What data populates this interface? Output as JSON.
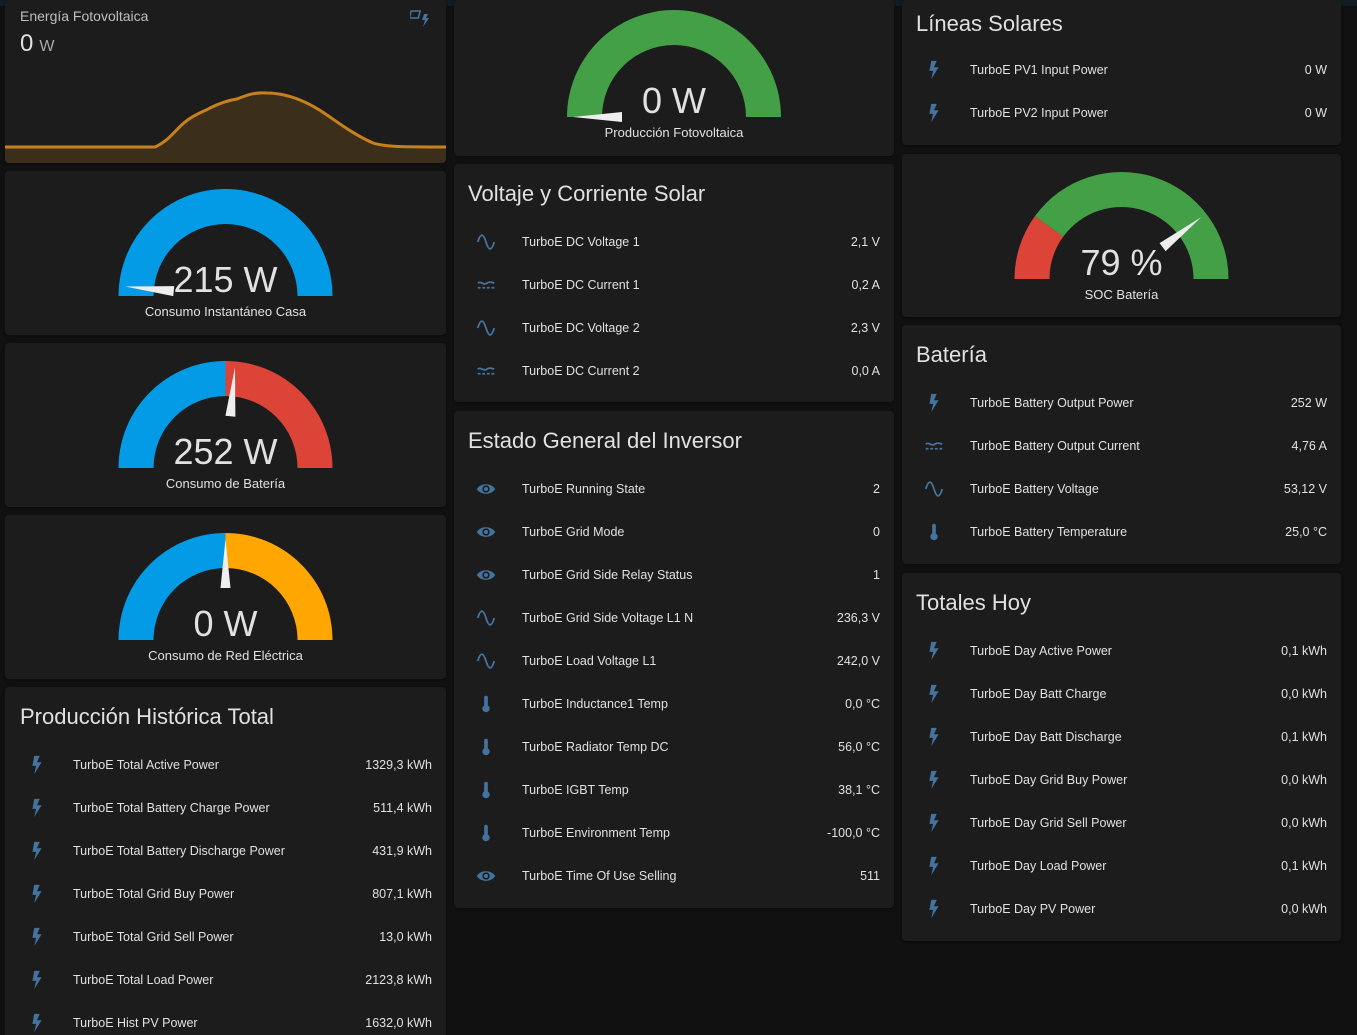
{
  "colors": {
    "background": "#111111",
    "card": "#1c1c1c",
    "icon": "#44739e",
    "gauge_blue": "#039be5",
    "gauge_green": "#43a047",
    "gauge_red": "#db4437",
    "gauge_orange": "#ffa600",
    "sensor_line": "#c8801c"
  },
  "energy_card": {
    "title": "Energía Fotovoltaica",
    "value": "0",
    "unit": "W",
    "icon": "solar-power-icon"
  },
  "gauges": {
    "production": {
      "value": "0 W",
      "name": "Producción Fotovoltaica",
      "level": 0.0
    },
    "house": {
      "value": "215 W",
      "name": "Consumo Instantáneo Casa",
      "level": 0.03
    },
    "battery": {
      "value": "252 W",
      "name": "Consumo de Batería",
      "level": 0.53
    },
    "grid": {
      "value": "0 W",
      "name": "Consumo de Red Eléctrica",
      "level": 0.5
    },
    "soc": {
      "value": "79 %",
      "name": "SOC Batería",
      "level": 0.79
    }
  },
  "cards": {
    "solar_lines": {
      "title": "Líneas Solares",
      "rows": [
        {
          "icon": "flash-icon",
          "name": "TurboE PV1 Input Power",
          "value": "0 W"
        },
        {
          "icon": "flash-icon",
          "name": "TurboE PV2 Input Power",
          "value": "0 W"
        }
      ]
    },
    "solar_voltage": {
      "title": "Voltaje y Corriente Solar",
      "rows": [
        {
          "icon": "sine-wave-icon",
          "name": "TurboE DC Voltage 1",
          "value": "2,1 V"
        },
        {
          "icon": "current-dc-icon",
          "name": "TurboE DC Current 1",
          "value": "0,2 A"
        },
        {
          "icon": "sine-wave-icon",
          "name": "TurboE DC Voltage 2",
          "value": "2,3 V"
        },
        {
          "icon": "current-dc-icon",
          "name": "TurboE DC Current 2",
          "value": "0,0 A"
        }
      ]
    },
    "inverter": {
      "title": "Estado General del Inversor",
      "rows": [
        {
          "icon": "eye-icon",
          "name": "TurboE Running State",
          "value": "2"
        },
        {
          "icon": "eye-icon",
          "name": "TurboE Grid Mode",
          "value": "0"
        },
        {
          "icon": "eye-icon",
          "name": "TurboE Grid Side Relay Status",
          "value": "1"
        },
        {
          "icon": "sine-wave-icon",
          "name": "TurboE Grid Side Voltage L1 N",
          "value": "236,3 V"
        },
        {
          "icon": "sine-wave-icon",
          "name": "TurboE Load Voltage L1",
          "value": "242,0 V"
        },
        {
          "icon": "thermometer-icon",
          "name": "TurboE Inductance1 Temp",
          "value": "0,0 °C"
        },
        {
          "icon": "thermometer-icon",
          "name": "TurboE Radiator Temp DC",
          "value": "56,0 °C"
        },
        {
          "icon": "thermometer-icon",
          "name": "TurboE IGBT Temp",
          "value": "38,1 °C"
        },
        {
          "icon": "thermometer-icon",
          "name": "TurboE Environment Temp",
          "value": "-100,0 °C"
        },
        {
          "icon": "eye-icon",
          "name": "TurboE Time Of Use Selling",
          "value": "511"
        }
      ]
    },
    "historic": {
      "title": "Producción Histórica Total",
      "rows": [
        {
          "icon": "flash-icon",
          "name": "TurboE Total Active Power",
          "value": "1329,3 kWh"
        },
        {
          "icon": "flash-icon",
          "name": "TurboE Total Battery Charge Power",
          "value": "511,4 kWh"
        },
        {
          "icon": "flash-icon",
          "name": "TurboE Total Battery Discharge Power",
          "value": "431,9 kWh"
        },
        {
          "icon": "flash-icon",
          "name": "TurboE Total Grid Buy Power",
          "value": "807,1 kWh"
        },
        {
          "icon": "flash-icon",
          "name": "TurboE Total Grid Sell Power",
          "value": "13,0 kWh"
        },
        {
          "icon": "flash-icon",
          "name": "TurboE Total Load Power",
          "value": "2123,8 kWh"
        },
        {
          "icon": "flash-icon",
          "name": "TurboE Hist PV Power",
          "value": "1632,0 kWh"
        }
      ]
    },
    "battery": {
      "title": "Batería",
      "rows": [
        {
          "icon": "flash-icon",
          "name": "TurboE Battery Output Power",
          "value": "252 W"
        },
        {
          "icon": "current-dc-icon",
          "name": "TurboE Battery Output Current",
          "value": "4,76 A"
        },
        {
          "icon": "sine-wave-icon",
          "name": "TurboE Battery Voltage",
          "value": "53,12 V"
        },
        {
          "icon": "thermometer-icon",
          "name": "TurboE Battery Temperature",
          "value": "25,0 °C"
        }
      ]
    },
    "today": {
      "title": "Totales Hoy",
      "rows": [
        {
          "icon": "flash-icon",
          "name": "TurboE Day Active Power",
          "value": "0,1 kWh"
        },
        {
          "icon": "flash-icon",
          "name": "TurboE Day Batt Charge",
          "value": "0,0 kWh"
        },
        {
          "icon": "flash-icon",
          "name": "TurboE Day Batt Discharge",
          "value": "0,1 kWh"
        },
        {
          "icon": "flash-icon",
          "name": "TurboE Day Grid Buy Power",
          "value": "0,0 kWh"
        },
        {
          "icon": "flash-icon",
          "name": "TurboE Day Grid Sell Power",
          "value": "0,0 kWh"
        },
        {
          "icon": "flash-icon",
          "name": "TurboE Day Load Power",
          "value": "0,1 kWh"
        },
        {
          "icon": "flash-icon",
          "name": "TurboE Day PV Power",
          "value": "0,0 kWh"
        }
      ]
    }
  }
}
